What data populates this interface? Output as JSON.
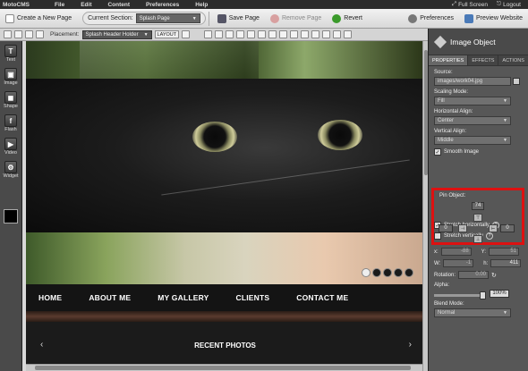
{
  "app": {
    "logo": "MotoCMS"
  },
  "menu": {
    "items": [
      "File",
      "Edit",
      "Content",
      "Preferences",
      "Help"
    ]
  },
  "window_controls": {
    "fullscreen": "Full Screen",
    "logout": "Logout"
  },
  "toolbar": {
    "create_page": "Create a New Page",
    "current_section_label": "Current Section:",
    "current_section_value": "Splash Page",
    "save": "Save Page",
    "remove": "Remove Page",
    "revert": "Revert",
    "preferences": "Preferences",
    "preview": "Preview Website"
  },
  "toolbar2": {
    "placement_label": "Placement:",
    "placement_value": "Splash Header Holder",
    "layout": "LAYOUT"
  },
  "tools": [
    {
      "label": "Text",
      "glyph": "T"
    },
    {
      "label": "Image",
      "glyph": "▣"
    },
    {
      "label": "Shape",
      "glyph": "◼"
    },
    {
      "label": "Flash",
      "glyph": "f"
    },
    {
      "label": "Video",
      "glyph": "▶"
    },
    {
      "label": "Widget",
      "glyph": "⚙"
    }
  ],
  "site": {
    "nav": [
      "HOME",
      "ABOUT ME",
      "MY GALLERY",
      "CLIENTS",
      "CONTACT ME"
    ],
    "recent": "RECENT PHOTOS"
  },
  "panel": {
    "title": "Image Object",
    "tabs": [
      "PROPERTIES",
      "EFFECTS",
      "ACTIONS"
    ],
    "source_label": "Source:",
    "source_value": "images/work04.jpg",
    "scaling_label": "Scaling Mode:",
    "scaling_value": "Fill",
    "halign_label": "Horizontal Align:",
    "halign_value": "Center",
    "valign_label": "Vertical Align:",
    "valign_value": "Middle",
    "smooth_label": "Smooth Image",
    "pin_label": "Pin Object:",
    "pin_top": "74",
    "pin_left": "0",
    "pin_right": "0",
    "stretch_h": "Stretch horizontally",
    "stretch_v": "Stretch vertically",
    "x_label": "x:",
    "x_value": "-88",
    "y_label": "Y:",
    "y_value": "51",
    "w_label": "W:",
    "w_value": "-1",
    "h_label": "h:",
    "h_value": "411",
    "rotation_label": "Rotation:",
    "rotation_value": "0.00",
    "alpha_label": "Alpha:",
    "alpha_value": "100%",
    "alpha_level": 1.0,
    "blend_label": "Blend Mode:",
    "blend_value": "Normal"
  },
  "colors": {
    "highlight": "#d11111",
    "panel": "#575757"
  }
}
